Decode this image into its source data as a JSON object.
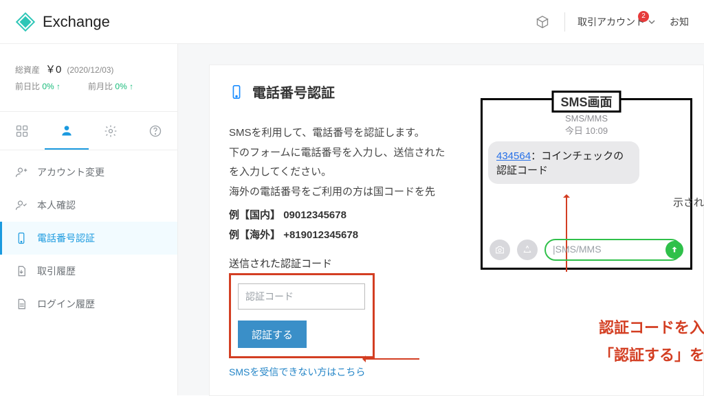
{
  "header": {
    "brand": "Exchange",
    "account_menu": "取引アカウント",
    "badge_count": "2",
    "tail": "お知"
  },
  "sidebar": {
    "assets_label": "総資産",
    "assets_value": "￥0",
    "assets_date": "(2020/12/03)",
    "prev_day_label": "前日比",
    "prev_day_pct": "0%",
    "prev_month_label": "前月比",
    "prev_month_pct": "0%",
    "nav": [
      {
        "label": "アカウント変更"
      },
      {
        "label": "本人確認"
      },
      {
        "label": "電話番号認証"
      },
      {
        "label": "取引履歴"
      },
      {
        "label": "ログイン履歴"
      }
    ]
  },
  "main": {
    "title": "電話番号認証",
    "desc_line1": "SMSを利用して、電話番号を認証します。",
    "desc_line2a": "下のフォームに電話番号を入力し、送信された",
    "desc_line2b": "を入力してください。",
    "desc_line3": "海外の電話番号をご利用の方は国コードを先",
    "example_domestic_label": "例【国内】",
    "example_domestic_value": "09012345678",
    "example_intl_label": "例【海外】",
    "example_intl_value": "+819012345678",
    "code_section_label": "送信された認証コード",
    "code_placeholder": "認証コード",
    "verify_button": "認証する",
    "sms_help_link": "SMSを受信できない方はこちら",
    "crop_tail": "示され"
  },
  "sms": {
    "caption": "SMS画面",
    "service": "SMS/MMS",
    "timestamp": "今日 10:09",
    "code": "434564",
    "message_tail": "：コインチェックの認証コード",
    "textfield_placeholder": "SMS/MMS"
  },
  "annotation": {
    "line1": "認証コードを入力して",
    "line2": "「認証する」をクリック"
  }
}
